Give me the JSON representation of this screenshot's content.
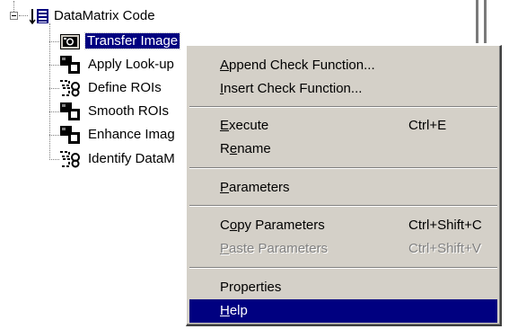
{
  "tree": {
    "root": {
      "label": "DataMatrix Code",
      "icon": "list-icon",
      "expander": "collapse-box-icon"
    },
    "children": [
      {
        "label": "Transfer Image",
        "icon": "camera-icon",
        "selected": true
      },
      {
        "label": "Apply Look-up",
        "icon": "step-blocks-icon"
      },
      {
        "label": "Define ROIs",
        "icon": "roi-icon"
      },
      {
        "label": "Smooth ROIs",
        "icon": "step-blocks-icon"
      },
      {
        "label": "Enhance Imag",
        "icon": "step-blocks-icon"
      },
      {
        "label": "Identify DataM",
        "icon": "roi-icon"
      }
    ]
  },
  "context_menu": {
    "items": [
      {
        "pre": "",
        "ul": "A",
        "post": "ppend Check Function...",
        "shortcut": "",
        "disabled": false,
        "highlight": false
      },
      {
        "pre": "",
        "ul": "I",
        "post": "nsert Check Function...",
        "shortcut": "",
        "disabled": false,
        "highlight": false
      },
      {
        "pre": "",
        "ul": "E",
        "post": "xecute",
        "shortcut": "Ctrl+E",
        "disabled": false,
        "highlight": false
      },
      {
        "pre": "R",
        "ul": "e",
        "post": "name",
        "shortcut": "",
        "disabled": false,
        "highlight": false
      },
      {
        "pre": "",
        "ul": "P",
        "post": "arameters",
        "shortcut": "",
        "disabled": false,
        "highlight": false
      },
      {
        "pre": "C",
        "ul": "o",
        "post": "py Parameters",
        "shortcut": "Ctrl+Shift+C",
        "disabled": false,
        "highlight": false
      },
      {
        "pre": "",
        "ul": "P",
        "post": "aste Parameters",
        "shortcut": "Ctrl+Shift+V",
        "disabled": true,
        "highlight": false
      },
      {
        "pre": "Properties",
        "ul": "",
        "post": "",
        "shortcut": "",
        "disabled": false,
        "highlight": false
      },
      {
        "pre": "",
        "ul": "H",
        "post": "elp",
        "shortcut": "",
        "disabled": false,
        "highlight": true
      }
    ]
  },
  "colors": {
    "selection": "#000080",
    "menu_bg": "#d4d0c8",
    "disabled_text": "#808080"
  }
}
